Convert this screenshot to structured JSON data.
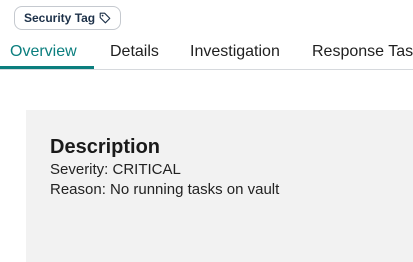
{
  "tag_chip": {
    "label": "Security Tag",
    "icon": "tag-icon"
  },
  "tabs": [
    {
      "label": "Overview",
      "active": true
    },
    {
      "label": "Details",
      "active": false
    },
    {
      "label": "Investigation",
      "active": false
    },
    {
      "label": "Response Tasks",
      "active": false
    }
  ],
  "description": {
    "title": "Description",
    "severity_line": "Severity: CRITICAL",
    "reason_line": "Reason: No running tasks on vault"
  },
  "colors": {
    "accent": "#0b7e7e",
    "panel_background": "#f2f2f2",
    "chip_text": "#1d3149"
  }
}
